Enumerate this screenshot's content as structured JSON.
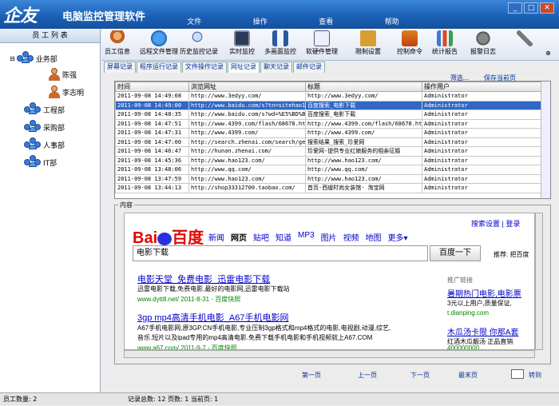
{
  "app": {
    "logo": "企友",
    "name": "电脑监控管理软件",
    "menus": [
      "文件",
      "操作",
      "查看",
      "帮助"
    ]
  },
  "left": {
    "header": "员 工 列 表",
    "groups": [
      "业务部",
      "工程部",
      "采购部",
      "人事部",
      "IT部"
    ],
    "members": [
      "陈强",
      "李志明"
    ]
  },
  "toolbar": [
    "员工信息",
    "远程文件管理",
    "历史监控记录",
    "实时监控",
    "多画面监控",
    "软硬件管理",
    "限制设置",
    "控制命令",
    "统计报告",
    "报警日志"
  ],
  "subtabs": [
    "屏幕记录",
    "程序运行记录",
    "文件操作记录",
    "网址记录",
    "聊天记录",
    "邮件记录"
  ],
  "links": {
    "filter": "筛选...",
    "save": "保存当前页"
  },
  "table": {
    "columns": [
      "时间",
      "浏览网址",
      "标题",
      "操作用户"
    ],
    "rows": [
      [
        "2011-09-08 14:49:08",
        "http://www.3edyy.com/",
        "http://www.3edyy.com/",
        "Administrator"
      ],
      [
        "2011-09-08 14:49:00",
        "http://www.baidu.com/s?tn=sitehao123",
        "百度搜索_电影下载",
        "Administrator"
      ],
      [
        "2011-09-08 14:48:35",
        "http://www.baidu.com/s?wd=%E5%BD%B1",
        "百度搜索_电影下载",
        "Administrator"
      ],
      [
        "2011-09-08 14:47:51",
        "http://www.4399.com/flash/68678.htm",
        "http://www.4399.com/flash/68678.htm",
        "Administrator"
      ],
      [
        "2011-09-08 14:47:31",
        "http://www.4399.com/",
        "http://www.4399.com/",
        "Administrator"
      ],
      [
        "2011-09-08 14:47:00",
        "http://search.zhenai.com/search/getfast",
        "搜索结果_搜索_珍爱网",
        "Administrator"
      ],
      [
        "2011-09-08 14:46:47",
        "http://hunan.zhenai.com/",
        "珍爱网-提供专业红娘服务的相亲征婚",
        "Administrator"
      ],
      [
        "2011-09-08 14:45:36",
        "http://www.hao123.com/",
        "http://www.hao123.com/",
        "Administrator"
      ],
      [
        "2011-09-08 13:48:06",
        "http://www.qq.com/",
        "http://www.qq.com/",
        "Administrator"
      ],
      [
        "2011-09-08 13:47:59",
        "http://www.hao123.com/",
        "http://www.hao123.com/",
        "Administrator"
      ],
      [
        "2011-09-08 13:44:13",
        "http://shop33312700.taobao.com/",
        "首页-西瑷时尚女装馆- 淘宝网",
        "Administrator"
      ]
    ]
  },
  "content": {
    "label": "内容",
    "baidu": {
      "logo_a": "Bai",
      "logo_b": "百度",
      "nav": [
        "新闻",
        "网页",
        "贴吧",
        "知道",
        "MP3",
        "图片",
        "视频",
        "地图",
        "更多▾"
      ],
      "top_links": "搜索设置 | 登录",
      "query": "电影下载",
      "search_btn": "百度一下",
      "tuijian": "推荐: 把百度",
      "r1_title": "电影天堂_免费电影_迅雷电影下载",
      "r1_desc": "迅雷电影下载,免费电影,最好的电影网,迅雷电影下载站",
      "r1_url": "www.dytt8.net/ 2011-8-31 - 百度快照",
      "r2_title": "3gp mp4高清手机电影_A67手机电影网",
      "r2_desc1": "A67手机电影网,原3GP.CN手机电影,专业压制3gp格式和mp4格式的电影,电视剧,动漫,综艺,",
      "r2_desc2": "音乐.短片以及ipad专用的mp4高清电影.免费下载手机电影和手机视频就上A67.COM",
      "r2_url": "www.a67.com/ 2011-9-7 - 百度快照",
      "side_head": "推广链接",
      "s1_title": "暑期热门电影,电影票",
      "s1_desc": "3元以上用户,质量保证,",
      "s1_url": "t.dianping.com",
      "s2_title": "木瓜汤卡限 你那A套",
      "s2_desc": "红酒木瓜靓汤 正品直销",
      "s2_url": "400000000"
    }
  },
  "pager": [
    "第一页",
    "上一页",
    "下一页",
    "最末页",
    "转到"
  ],
  "status": {
    "employees": "员工数量: 2",
    "records": "记录总数: 12   页数: 1   当前页: 1"
  }
}
